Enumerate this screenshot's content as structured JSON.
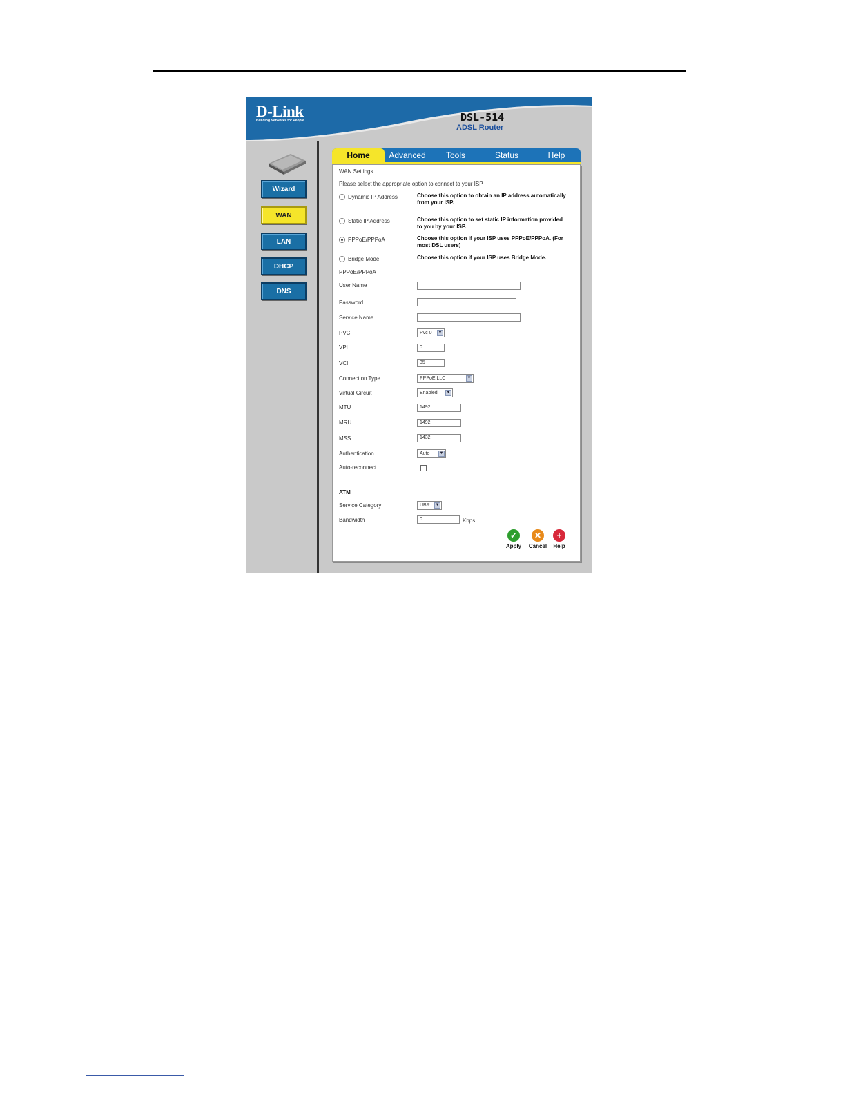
{
  "header": {
    "logo": "D-Link",
    "tagline": "Building Networks for People",
    "model": "DSL-514",
    "model_sub": "ADSL Router"
  },
  "sidebar": {
    "items": [
      {
        "label": "Wizard",
        "active": false
      },
      {
        "label": "WAN",
        "active": true
      },
      {
        "label": "LAN",
        "active": false
      },
      {
        "label": "DHCP",
        "active": false
      },
      {
        "label": "DNS",
        "active": false
      }
    ]
  },
  "tabs": [
    {
      "label": "Home",
      "active": true
    },
    {
      "label": "Advanced",
      "active": false
    },
    {
      "label": "Tools",
      "active": false
    },
    {
      "label": "Status",
      "active": false
    },
    {
      "label": "Help",
      "active": false
    }
  ],
  "main": {
    "section_title": "WAN Settings",
    "instruction": "Please select the appropriate option to connect to your ISP",
    "options": [
      {
        "label": "Dynamic IP Address",
        "desc": "Choose this option to obtain an IP address automatically from your ISP.",
        "selected": false
      },
      {
        "label": "Static IP Address",
        "desc": "Choose this option to set static IP information provided to you by your ISP.",
        "selected": false
      },
      {
        "label": "PPPoE/PPPoA",
        "desc": "Choose this option if your ISP uses PPPoE/PPPoA. (For most DSL users)",
        "selected": true
      },
      {
        "label": "Bridge Mode",
        "desc": "Choose this option if your ISP uses Bridge Mode.",
        "selected": false
      }
    ],
    "pppoe_title": "PPPoE/PPPoA",
    "fields": {
      "user_name": {
        "label": "User Name",
        "value": ""
      },
      "password": {
        "label": "Password",
        "value": ""
      },
      "service_name": {
        "label": "Service Name",
        "value": ""
      },
      "pvc": {
        "label": "PVC",
        "value": "Pvc 0"
      },
      "vpi": {
        "label": "VPI",
        "value": "0"
      },
      "vci": {
        "label": "VCI",
        "value": "35"
      },
      "connection_type": {
        "label": "Connection Type",
        "value": "PPPoE LLC"
      },
      "virtual_circuit": {
        "label": "Virtual Circuit",
        "value": "Enabled"
      },
      "mtu": {
        "label": "MTU",
        "value": "1492"
      },
      "mru": {
        "label": "MRU",
        "value": "1492"
      },
      "mss": {
        "label": "MSS",
        "value": "1432"
      },
      "authentication": {
        "label": "Authentication",
        "value": "Auto"
      },
      "auto_reconnect": {
        "label": "Auto-reconnect",
        "checked": false
      }
    },
    "atm": {
      "title": "ATM",
      "service_category": {
        "label": "Service Category",
        "value": "UBR"
      },
      "bandwidth": {
        "label": "Bandwidth",
        "value": "0",
        "unit": "Kbps"
      }
    },
    "actions": {
      "apply": "Apply",
      "cancel": "Cancel",
      "help": "Help"
    }
  },
  "colors": {
    "brand_blue": "#1d73b8",
    "active_yellow": "#f5e52a",
    "apply_green": "#2e9e2e",
    "cancel_orange": "#e88a1a",
    "help_red": "#d8283a"
  }
}
